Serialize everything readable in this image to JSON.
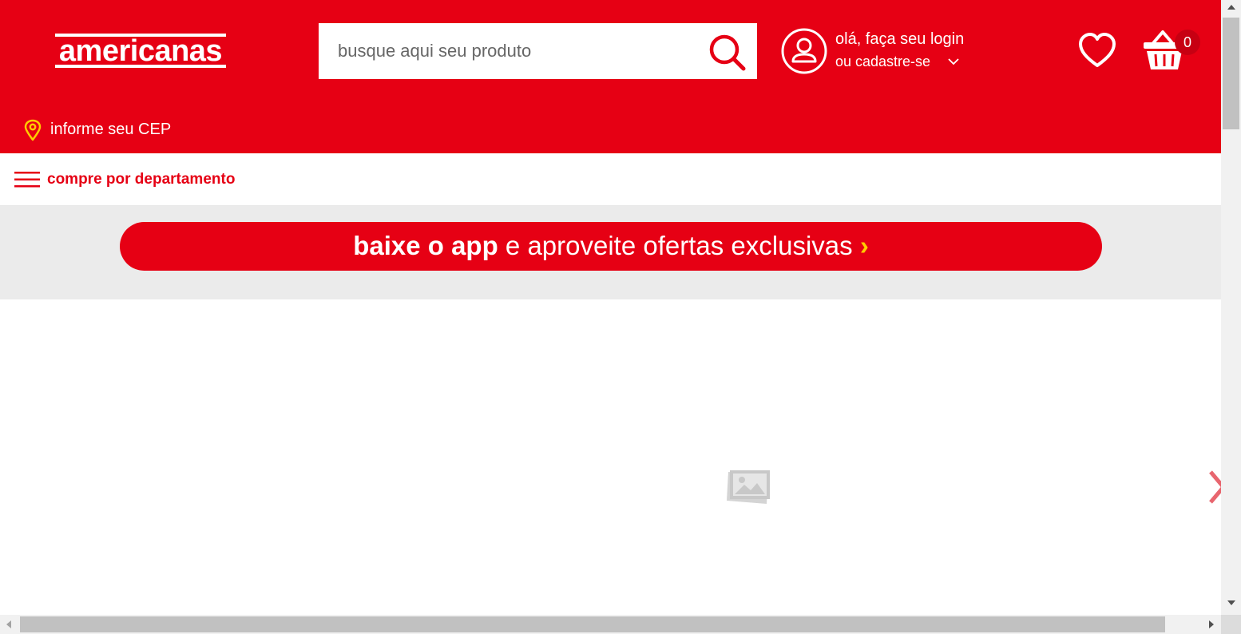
{
  "header": {
    "logo_text": "americanas",
    "search": {
      "placeholder": "busque aqui seu produto",
      "value": ""
    },
    "account": {
      "greeting": "olá, faça seu login",
      "subtext": "ou cadastre-se"
    },
    "cart": {
      "count": "0"
    },
    "cep": {
      "label": "informe seu CEP"
    }
  },
  "department_bar": {
    "label": "compre por departamento"
  },
  "app_banner": {
    "bold": "baixe o app",
    "rest": " e aproveite ofertas exclusivas ",
    "arrow": "›"
  },
  "icons": {
    "search": "search-icon",
    "user": "user-icon",
    "heart": "heart-icon",
    "basket": "basket-icon",
    "pin": "location-pin-icon",
    "menu": "hamburger-menu-icon",
    "image": "image-placeholder-icon",
    "next": "chevron-right-icon"
  },
  "colors": {
    "brand": "#e60014",
    "accent": "#ffcc00",
    "banner_bg": "#ebebeb"
  }
}
